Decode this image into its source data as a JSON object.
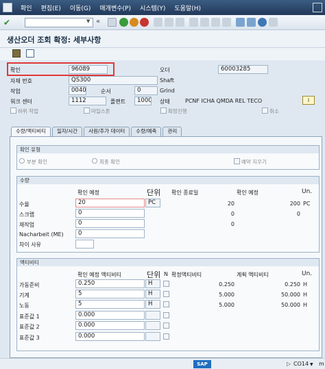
{
  "menu": [
    "확인",
    "편집(E)",
    "이동(G)",
    "매개변수(P)",
    "시스템(Y)",
    "도움말(H)"
  ],
  "toolbar": {
    "command_placeholder": "",
    "chev": "«"
  },
  "title": "생산오더 조회 확정: 세부사항",
  "header": {
    "confirm_label": "확인",
    "confirm_value": "96089",
    "order_label": "오더",
    "order_value": "60003285",
    "material_label": "자재 번호",
    "material_value": "QS300",
    "shaft": "Shaft",
    "op_label": "작업",
    "op_value": "0040",
    "seq_label": "순서",
    "seq_value": "0",
    "op_text": "Grind",
    "wc_label": "워크 센터",
    "wc_value": "1112",
    "plant_label": "플랜트",
    "plant_value": "1000",
    "status_label": "상태",
    "status_value": "PCNF ICHA QMDA REL  TECO",
    "chk_sub": "하위 작업",
    "chk_milestone": "마일스톤",
    "chk_final": "확정진행",
    "chk_cancel": "취소",
    "info_icon": "i"
  },
  "tabs": [
    "수량/액티비티",
    "일자/시간",
    "사원/추가 데이터",
    "수량/예측",
    "관리"
  ],
  "confirm_type": {
    "heading": "확인 유형",
    "partial": "부분 확인",
    "final": "최종 확인",
    "clear_reservation": "예약 지우기"
  },
  "quantities": {
    "heading": "수량",
    "col_to_confirm": "확인 예정",
    "col_unit": "단위",
    "col_confirmed_total": "확인 종료일",
    "col_planned": "확인 예정",
    "col_un": "Un.",
    "rows": [
      {
        "label": "수율",
        "value": "20",
        "unit": "PC",
        "confirmed": "20",
        "planned": "200",
        "un": "PC"
      },
      {
        "label": "스크랩",
        "value": "0",
        "unit": "",
        "confirmed": "0",
        "planned": "0",
        "un": ""
      },
      {
        "label": "재작업",
        "value": "0",
        "unit": "",
        "confirmed": "0",
        "planned": "",
        "un": ""
      },
      {
        "label": "Nacharbeit (ME)",
        "value": "0",
        "unit": "",
        "confirmed": "",
        "planned": "",
        "un": ""
      },
      {
        "label": "차이 사유",
        "value": "",
        "unit": "",
        "confirmed": "",
        "planned": "",
        "un": ""
      }
    ]
  },
  "activities": {
    "heading": "액티비티",
    "col_to_confirm": "확인 예정 액티비티",
    "col_unit": "단위",
    "col_n": "N",
    "col_confirmed": "확정액티비티",
    "col_planned": "계획 액티비티",
    "col_un": "Un.",
    "rows": [
      {
        "label": "가동준비",
        "value": "0.250",
        "unit": "H",
        "confirmed": "0.250",
        "planned": "0.250",
        "un": "H"
      },
      {
        "label": "기계",
        "value": "5",
        "unit": "H",
        "confirmed": "5.000",
        "planned": "50.000",
        "un": "H"
      },
      {
        "label": "노동",
        "value": "5",
        "unit": "H",
        "confirmed": "5.000",
        "planned": "50.000",
        "un": "H"
      },
      {
        "label": "표준값 1",
        "value": "0.000",
        "unit": "",
        "confirmed": "",
        "planned": "",
        "un": ""
      },
      {
        "label": "표준값 2",
        "value": "0.000",
        "unit": "",
        "confirmed": "",
        "planned": "",
        "un": ""
      },
      {
        "label": "표준값 3",
        "value": "0.000",
        "unit": "",
        "confirmed": "",
        "planned": "",
        "un": ""
      }
    ]
  },
  "status_bar": {
    "sap": "SAP",
    "tcode": "CO14",
    "extra": "m"
  }
}
